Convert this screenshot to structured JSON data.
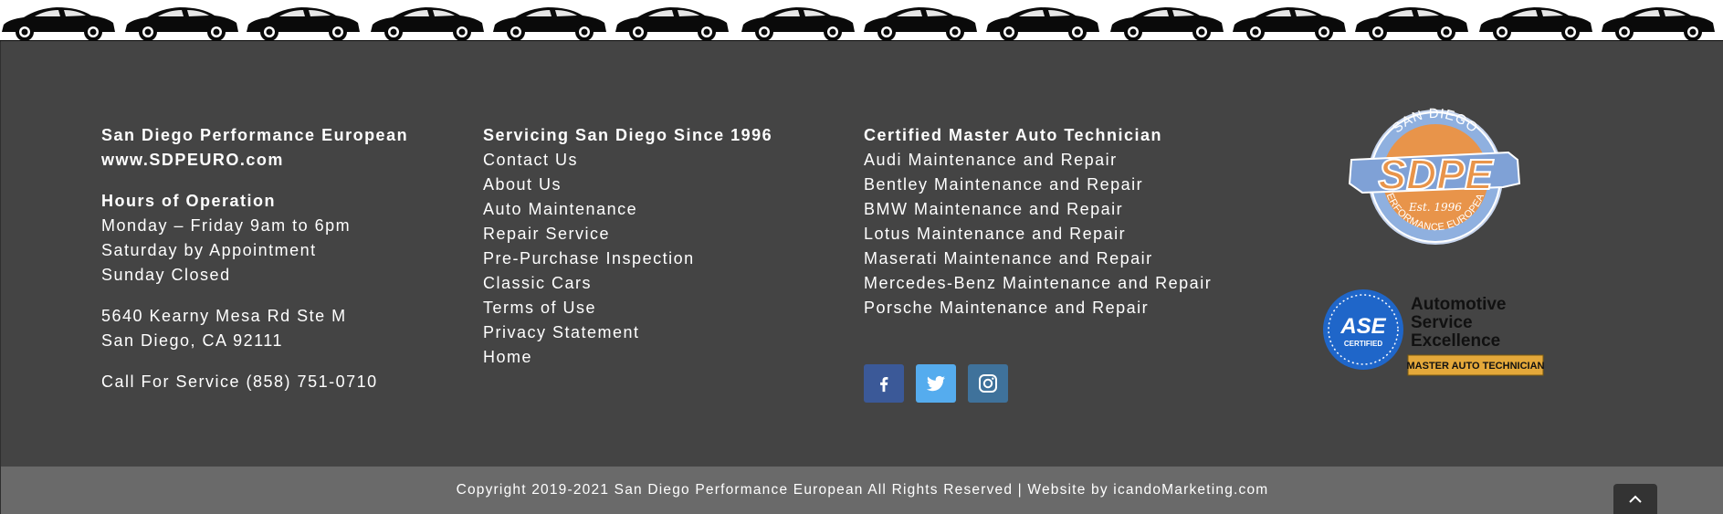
{
  "column1": {
    "company_name": "San Diego Performance European",
    "website": "www.SDPEURO.com",
    "hours_heading": "Hours of Operation",
    "hours": [
      "Monday – Friday 9am to 6pm",
      "Saturday by Appointment",
      "Sunday Closed"
    ],
    "address_line1": "5640 Kearny Mesa Rd Ste M",
    "address_line2": "San Diego, CA  92111",
    "phone_line": "Call For Service (858) 751-0710"
  },
  "column2": {
    "heading": "Servicing San Diego Since 1996",
    "links": [
      "Contact Us",
      "About Us",
      "Auto Maintenance",
      "Repair Service",
      "Pre-Purchase Inspection",
      "Classic Cars",
      "Terms of Use",
      "Privacy Statement",
      "Home"
    ]
  },
  "column3": {
    "heading": "Certified Master Auto Technician",
    "links": [
      "Audi Maintenance and Repair",
      "Bentley Maintenance and Repair",
      "BMW Maintenance and Repair",
      "Lotus Maintenance and Repair",
      "Maserati Maintenance and Repair",
      "Mercedes-Benz Maintenance and Repair",
      "Porsche Maintenance and Repair"
    ]
  },
  "social": {
    "icons": [
      "facebook-icon",
      "twitter-icon",
      "instagram-icon"
    ],
    "colors": {
      "facebook": "#3b5998",
      "twitter": "#55acee",
      "instagram": "#3f729b"
    }
  },
  "sdpe_logo": {
    "top_text": "SAN DIEGO",
    "main_text": "SDPE",
    "est_text": "Est. 1996",
    "bottom_text": "PERFORMANCE EUROPEAN"
  },
  "ase_badge": {
    "seal_text": "ASE",
    "seal_sub": "CERTIFIED",
    "line1": "Automotive",
    "line2": "Service",
    "line3": "Excellence",
    "ribbon": "MASTER AUTO TECHNICIAN"
  },
  "footer_bottom": {
    "copyright": "Copyright 2019-2021 San Diego Performance European All Rights Reserved | Website by icandoMarketing.com"
  },
  "colors": {
    "footer_bg": "#444444",
    "bottom_bar_bg": "#6a6a6a",
    "logo_orange": "#e8944a",
    "logo_blue": "#7fa1d6",
    "ase_blue": "#1f66c9"
  }
}
